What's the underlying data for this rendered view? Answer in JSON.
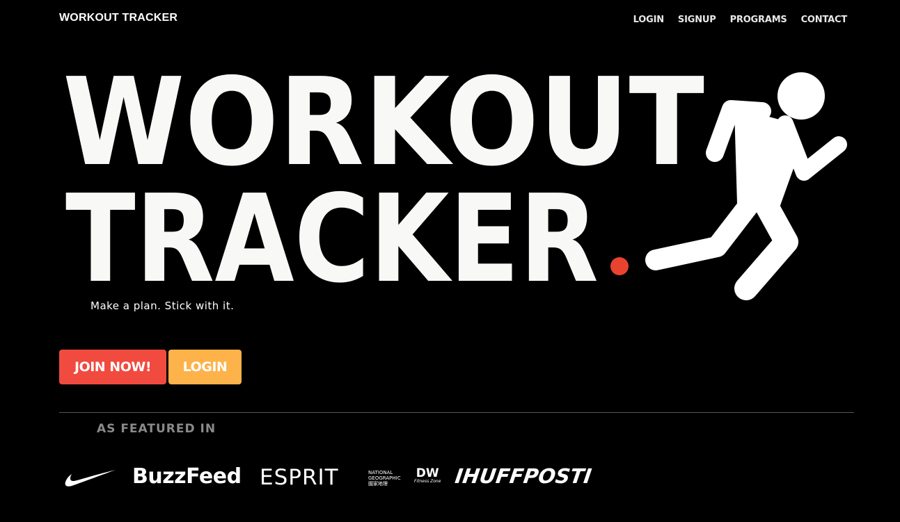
{
  "header": {
    "brand": "WORKOUT TRACKER",
    "nav": [
      "LOGIN",
      "SIGNUP",
      "PROGRAMS",
      "CONTACT"
    ]
  },
  "hero": {
    "title_line1": "WORKOUT",
    "title_line2": "TRACKER",
    "title_dot": ".",
    "tagline": "Make a plan. Stick with it.",
    "runner_icon": "running-person-icon"
  },
  "actions": {
    "join_label": "JOIN NOW!",
    "login_label": "LOGIN"
  },
  "featured": {
    "label": "AS FEATURED IN",
    "logos": {
      "nike": "nike-swoosh-icon",
      "buzzfeed": "BuzzFeed",
      "esprit": "ESPRIT",
      "natgeo_line1": "NATIONAL",
      "natgeo_line2": "GEOGRAPHIC",
      "natgeo_line3": "國家地理",
      "dw": "DW",
      "dw_sub": "Fitness Zone",
      "huffpost": "IHUFFPOSTI"
    }
  },
  "colors": {
    "background": "#000000",
    "accent_red": "#f14a3f",
    "accent_orange": "#fdb24a",
    "dot_red": "#e8432f",
    "title_white": "#f8f8f6"
  }
}
